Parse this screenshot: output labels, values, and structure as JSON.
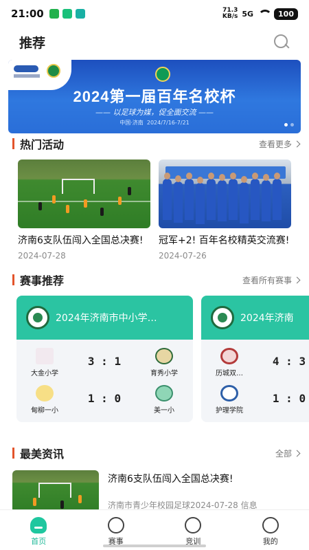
{
  "status": {
    "time": "21:00",
    "net_speed_value": "71.3",
    "net_speed_unit": "KB/s",
    "signal": "5G",
    "battery": "100"
  },
  "header": {
    "title": "推荐"
  },
  "banner": {
    "title": "2024第一届百年名校杯",
    "subtitle": "以足球为媒，促全面交流",
    "location": "中国·济南",
    "dates": "2024/7/16-7/21"
  },
  "hot": {
    "title": "热门活动",
    "more": "查看更多",
    "items": [
      {
        "title": "济南6支队伍闯入全国总决赛!",
        "date": "2024-07-28"
      },
      {
        "title": "冠军+2!  百年名校精英交流赛!",
        "date": "2024-07-26"
      }
    ]
  },
  "matches": {
    "title": "赛事推荐",
    "more": "查看所有赛事",
    "items": [
      {
        "name": "2024年济南市中小学…",
        "games": [
          {
            "home": "大金小学",
            "score": "3 : 1",
            "away": "育秀小学"
          },
          {
            "home": "甸柳一小",
            "score": "1 : 0",
            "away": "美一小"
          }
        ]
      },
      {
        "name": "2024年济南",
        "games": [
          {
            "home": "历城双…",
            "score": "4 : 3",
            "away": ""
          },
          {
            "home": "护理学院",
            "score": "1 : 0",
            "away": ""
          }
        ]
      }
    ]
  },
  "news": {
    "title": "最美资讯",
    "more": "全部",
    "items": [
      {
        "title": "济南6支队伍闯入全国总决赛!",
        "source": "济南市青少年校园足球",
        "date": "2024-07-28",
        "tag": "信息"
      }
    ]
  },
  "tabs": [
    {
      "label": "首页",
      "icon": "home-icon",
      "active": true
    },
    {
      "label": "赛事",
      "icon": "clock-icon",
      "active": false
    },
    {
      "label": "竞训",
      "icon": "compass-icon",
      "active": false
    },
    {
      "label": "我的",
      "icon": "face-icon",
      "active": false
    }
  ],
  "colors": {
    "accent": "#1fc79f",
    "section_bar": "#e3542b",
    "match_header": "#2bc4a2"
  }
}
